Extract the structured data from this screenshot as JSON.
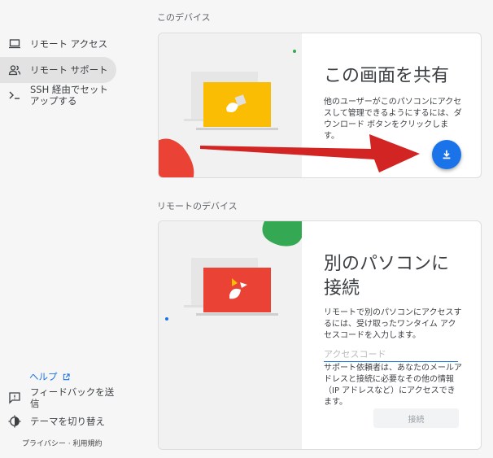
{
  "sidebar": {
    "items": [
      {
        "label": "リモート アクセス",
        "icon": "laptop-icon",
        "active": false
      },
      {
        "label": "リモート サポート",
        "icon": "people-icon",
        "active": true
      },
      {
        "label": "SSH 経由でセットアップする",
        "icon": "terminal-icon",
        "active": false
      }
    ],
    "help_label": "ヘルプ",
    "bottom_items": [
      {
        "label": "フィードバックを送信",
        "icon": "feedback-icon"
      },
      {
        "label": "テーマを切り替え",
        "icon": "theme-icon"
      }
    ],
    "privacy_label": "プライバシー",
    "terms_label": "利用規約"
  },
  "this_device": {
    "section_label": "このデバイス",
    "title": "この画面を共有",
    "description": "他のユーザーがこのパソコンにアクセスして管理できるようにするには、ダウンロード ボタンをクリックします。"
  },
  "remote_devices": {
    "section_label": "リモートのデバイス",
    "title_line1": "別のパソコンに",
    "title_line2": "接続",
    "description": "リモートで別のパソコンにアクセスするには、受け取ったワンタイム アクセスコードを入力します。",
    "input_placeholder": "アクセスコード",
    "input_value": "",
    "note": "サポート依頼者は、あなたのメールアドレスと接続に必要なその他の情報（IP アドレスなど）にアクセスできます。",
    "connect_label": "接続"
  },
  "colors": {
    "accent": "#1a73e8",
    "illustration_yellow": "#fbbc04",
    "illustration_red": "#ea4335",
    "illustration_green": "#34a853",
    "arrow_red": "#d32424"
  }
}
